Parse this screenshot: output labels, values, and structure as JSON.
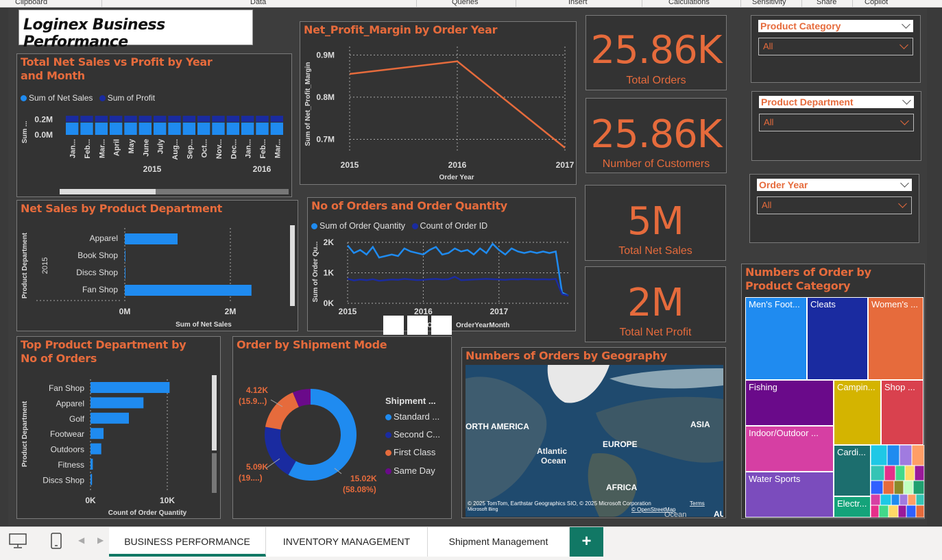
{
  "ribbon": {
    "groups": [
      "Clipboard",
      "Data",
      "Queries",
      "Insert",
      "Calculations",
      "Sensitivity",
      "Share",
      "Copilot"
    ]
  },
  "report_title": "Loginex Business Performance",
  "kpis": [
    {
      "value": "25.86K",
      "label": "Total Orders"
    },
    {
      "value": "25.86K",
      "label": "Number of Customers"
    },
    {
      "value": "5M",
      "label": "Total Net Sales"
    },
    {
      "value": "2M",
      "label": "Total Net Profit"
    }
  ],
  "slicers": [
    {
      "header": "Product Category",
      "value": "All"
    },
    {
      "header": "Product Department",
      "value": "All"
    },
    {
      "header": "Order Year",
      "value": "All"
    }
  ],
  "colors": {
    "accent": "#e66b3c",
    "series1": "#1f8bf0",
    "series2": "#1a2ba0",
    "bg": "#333333",
    "tab_green": "#117865"
  },
  "sales_vs_profit": {
    "title": "Total Net Sales vs Profit by Year and Month",
    "legend": [
      "Sum of Net  Sales",
      "Sum of Profit"
    ],
    "yaxis_label": "Sum ...",
    "yticks": [
      "0.2M",
      "0.0M"
    ],
    "months": [
      "Jan...",
      "Feb...",
      "Mar...",
      "April",
      "May",
      "June",
      "July",
      "Aug...",
      "Sep...",
      "Oct...",
      "Nov...",
      "Dec...",
      "Jan...",
      "Feb...",
      "Mar..."
    ],
    "years": [
      "2015",
      "2016"
    ]
  },
  "margin_chart": {
    "title": "Net_Profit_Margin by Order Year",
    "ylabel": "Sum of Net_Profit_Margin",
    "xlabel": "Order Year",
    "yticks": [
      "0.9M",
      "0.8M",
      "0.7M"
    ],
    "xticks": [
      "2015",
      "2016",
      "2017"
    ]
  },
  "dept_sales": {
    "title": "Net Sales by Product Department",
    "ylabel": "Product Department",
    "year": "2015",
    "xlabel": "Sum of Net Sales",
    "xticks": [
      "0M",
      "2M"
    ]
  },
  "orders_qty": {
    "title": "No of Orders and Order Quantity",
    "legend": [
      "Sum of Order Quantity",
      "Count of Order ID"
    ],
    "ylabel": "Sum of Order Qu...",
    "yticks": [
      "2K",
      "1K",
      "0K"
    ],
    "xticks": [
      "2015",
      "2016",
      "2017"
    ],
    "xlabel": "OrderYearMonth",
    "xlabel_prefix": "O"
  },
  "top_dept": {
    "title": "Top Product Department by No of Orders",
    "ylabel": "Product Department",
    "xlabel": "Count of Order Quantity",
    "xticks": [
      "0K",
      "10K"
    ]
  },
  "shipment": {
    "title": "Order by Shipment Mode",
    "legend_title": "Shipment ...",
    "legend": [
      "Standard ...",
      "Second C...",
      "First Class",
      "Same Day"
    ],
    "labels": [
      {
        "v": "4.12K",
        "p": "(15.9...)"
      },
      {
        "v": "5.09K",
        "p": "(19....)"
      },
      {
        "v": "15.02K",
        "p": "(58.08%)"
      }
    ]
  },
  "geo": {
    "title": "Numbers of Orders by Geography",
    "labels": [
      "ORTH AMERICA",
      "EUROPE",
      "ASIA",
      "Atlantic",
      "Ocean",
      "AFRICA",
      "AU",
      "Ocean"
    ],
    "credit": "© 2025 TomTom, Earthstar Geographics SIO, © 2025 Microsoft Corporation",
    "terms": "Terms",
    "osm": "© OpenStreetMap",
    "bing": "Microsoft Bing"
  },
  "treemap": {
    "title": "Numbers of Order by Product Category",
    "tiles": [
      "Men's Foot...",
      "Cleats",
      "Women's ...",
      "Fishing",
      "Campin...",
      "Shop ...",
      "Indoor/Outdoor ...",
      "Cardi...",
      "Water Sports",
      "Electr..."
    ]
  },
  "tabs": [
    "BUSINESS PERFORMANCE",
    "INVENTORY MANAGEMENT",
    "Shipment Management"
  ],
  "add_tab": "+",
  "chart_data": [
    {
      "type": "bar",
      "title": "Total Net Sales vs Profit by Year and Month",
      "categories": [
        "Jan 2015",
        "Feb 2015",
        "Mar 2015",
        "April 2015",
        "May 2015",
        "June 2015",
        "July 2015",
        "Aug 2015",
        "Sep 2015",
        "Oct 2015",
        "Nov 2015",
        "Dec 2015",
        "Jan 2016",
        "Feb 2016",
        "Mar 2016"
      ],
      "series": [
        {
          "name": "Sum of Net  Sales",
          "values": [
            0.16,
            0.16,
            0.16,
            0.16,
            0.16,
            0.16,
            0.16,
            0.16,
            0.16,
            0.16,
            0.16,
            0.16,
            0.16,
            0.16,
            0.16
          ]
        },
        {
          "name": "Sum of Profit",
          "values": [
            0.08,
            0.08,
            0.08,
            0.08,
            0.08,
            0.08,
            0.08,
            0.08,
            0.08,
            0.08,
            0.08,
            0.08,
            0.08,
            0.08,
            0.08
          ]
        }
      ],
      "ylabel": "Sum ...",
      "ylim": [
        0,
        0.25
      ]
    },
    {
      "type": "line",
      "title": "Net_Profit_Margin by Order Year",
      "x": [
        2015,
        2016,
        2017
      ],
      "values": [
        0.855,
        0.885,
        0.68
      ],
      "xlabel": "Order Year",
      "ylabel": "Sum of Net_Profit_Margin",
      "ylim": [
        0.67,
        0.92
      ]
    },
    {
      "type": "bar",
      "title": "Net Sales by Product Department",
      "categories": [
        "Apparel",
        "Book Shop",
        "Discs Shop",
        "Fan Shop"
      ],
      "values": [
        1.0,
        0.01,
        0.01,
        2.4
      ],
      "xlabel": "Sum of Net Sales",
      "xlim": [
        0,
        3
      ]
    },
    {
      "type": "line",
      "title": "No of Orders and Order Quantity",
      "x": [
        "2015-01",
        "2015-02",
        "2015-03",
        "2015-04",
        "2015-05",
        "2015-06",
        "2015-07",
        "2015-08",
        "2015-09",
        "2015-10",
        "2015-11",
        "2015-12",
        "2016-01",
        "2016-02",
        "2016-03",
        "2016-04",
        "2016-05",
        "2016-06",
        "2016-07",
        "2016-08",
        "2016-09",
        "2016-10",
        "2016-11",
        "2016-12",
        "2017-01",
        "2017-02",
        "2017-03",
        "2017-04",
        "2017-05",
        "2017-06",
        "2017-07",
        "2017-08",
        "2017-09",
        "2017-10",
        "2017-11",
        "2017-12"
      ],
      "series": [
        {
          "name": "Sum of Order Quantity",
          "values": [
            1900,
            1650,
            1750,
            1600,
            1850,
            1500,
            1550,
            1600,
            1550,
            1800,
            1700,
            1650,
            1600,
            1750,
            1850,
            1600,
            1650,
            1800,
            1700,
            1750,
            1600,
            1800,
            1650,
            1950,
            1750,
            1600,
            1800,
            1700,
            1650,
            1700,
            1650,
            1700,
            1650,
            1700,
            350,
            250
          ]
        },
        {
          "name": "Count of Order ID",
          "values": [
            800,
            750,
            780,
            760,
            790,
            740,
            760,
            780,
            770,
            800,
            780,
            760,
            770,
            790,
            800,
            780,
            790,
            870,
            760,
            770,
            780,
            790,
            800,
            790,
            780,
            770,
            790,
            780,
            800,
            790,
            780,
            790,
            780,
            800,
            300,
            250
          ]
        }
      ],
      "ylabel": "Sum of Order Qu...",
      "xlabel": "OrderYearMonth",
      "ylim": [
        0,
        2000
      ]
    },
    {
      "type": "bar",
      "title": "Top Product Department by No of Orders",
      "categories": [
        "Fan Shop",
        "Apparel",
        "Golf",
        "Footwear",
        "Outdoors",
        "Fitness",
        "Discs Shop"
      ],
      "values": [
        10300,
        6900,
        5000,
        1700,
        1400,
        300,
        200
      ],
      "xlabel": "Count of Order Quantity",
      "xlim": [
        0,
        12000
      ]
    },
    {
      "type": "pie",
      "title": "Order by Shipment Mode",
      "categories": [
        "Standard ...",
        "Second C...",
        "First Class",
        "Same Day"
      ],
      "values": [
        15020,
        5090,
        4120,
        1640
      ]
    },
    {
      "type": "heatmap",
      "title": "Numbers of Order by Product Category",
      "categories": [
        "Men's Foot...",
        "Cleats",
        "Women's ...",
        "Fishing",
        "Campin...",
        "Shop ...",
        "Indoor/Outdoor ...",
        "Cardi...",
        "Water Sports",
        "Electr..."
      ]
    }
  ]
}
